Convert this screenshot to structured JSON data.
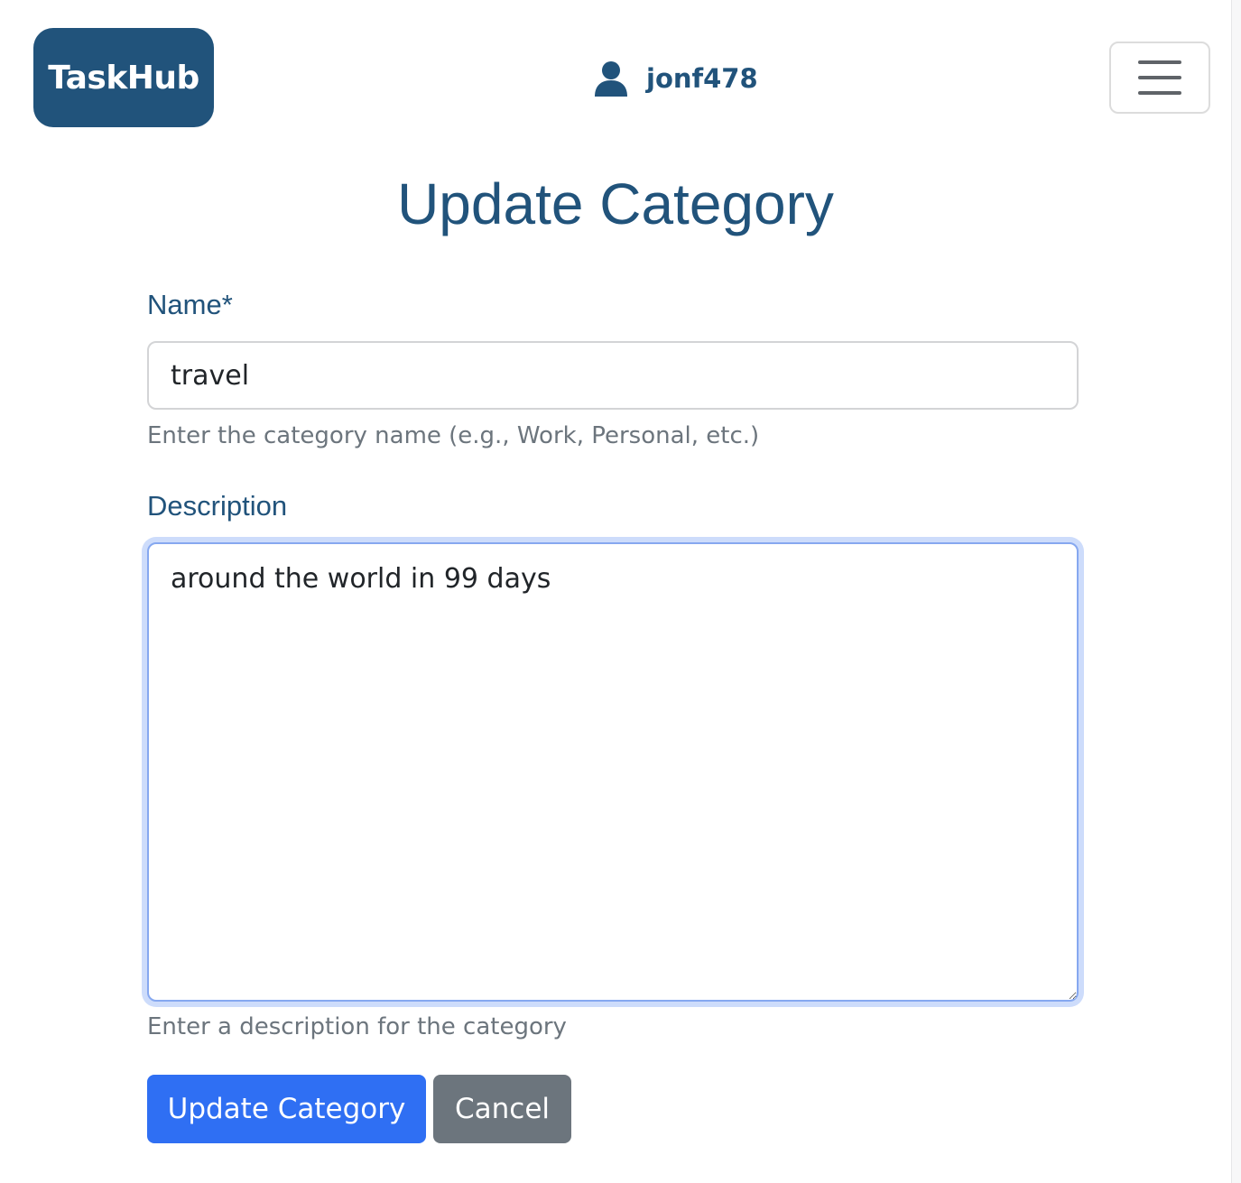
{
  "header": {
    "brand": "TaskHub",
    "username": "jonf478",
    "user_icon": "user-icon",
    "menu_icon": "hamburger-menu-icon"
  },
  "main": {
    "title": "Update Category",
    "name_field": {
      "label": "Name*",
      "value": "travel",
      "help": "Enter the category name (e.g., Work, Personal, etc.)"
    },
    "description_field": {
      "label": "Description",
      "value": "around the world in 99 days",
      "help": "Enter a description for the category"
    },
    "buttons": {
      "submit_label": "Update Category",
      "cancel_label": "Cancel"
    }
  },
  "colors": {
    "brand": "#21537b",
    "primary": "#2f6ff3",
    "secondary": "#6c757d",
    "help_text": "#6c757d",
    "focus_ring": "#cddcfb"
  }
}
